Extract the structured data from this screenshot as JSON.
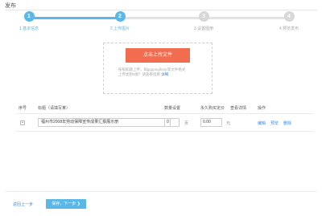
{
  "page": {
    "title": "发布"
  },
  "steps": [
    {
      "num": "1",
      "label": "1.基本信息",
      "state": "done"
    },
    {
      "num": "2",
      "label": "2.上传图片",
      "state": "done"
    },
    {
      "num": "3",
      "label": "3.设置图册",
      "state": "todo"
    },
    {
      "num": "4",
      "label": "4.预览发布",
      "state": "todo"
    }
  ],
  "upload": {
    "button_label": "点击上传文件",
    "hint_line1": "按照如题上传，如jpg/png/bmp等文件格式",
    "hint_line2_prefix": "上传类别5图？请查看指南",
    "hint_link": "详细"
  },
  "table": {
    "headers": {
      "seq": "序号",
      "title": "标题（请填写某）",
      "qty": "数量设置",
      "price": "永久购买定价",
      "detail": "查看详情",
      "ops": "操作"
    },
    "rows": [
      {
        "expand": "+",
        "title_value": "福州市2008年劳动保障宣传成果汇报展示册",
        "qty_value": "0",
        "qty_unit": "页",
        "price_value": "0.00",
        "price_unit": "元",
        "op_edit": "编辑",
        "op_preview": "预览",
        "op_delete": "删除"
      }
    ]
  },
  "footer": {
    "prev_label": "返回上一步",
    "next_label": "保存，下一步 ❯"
  }
}
